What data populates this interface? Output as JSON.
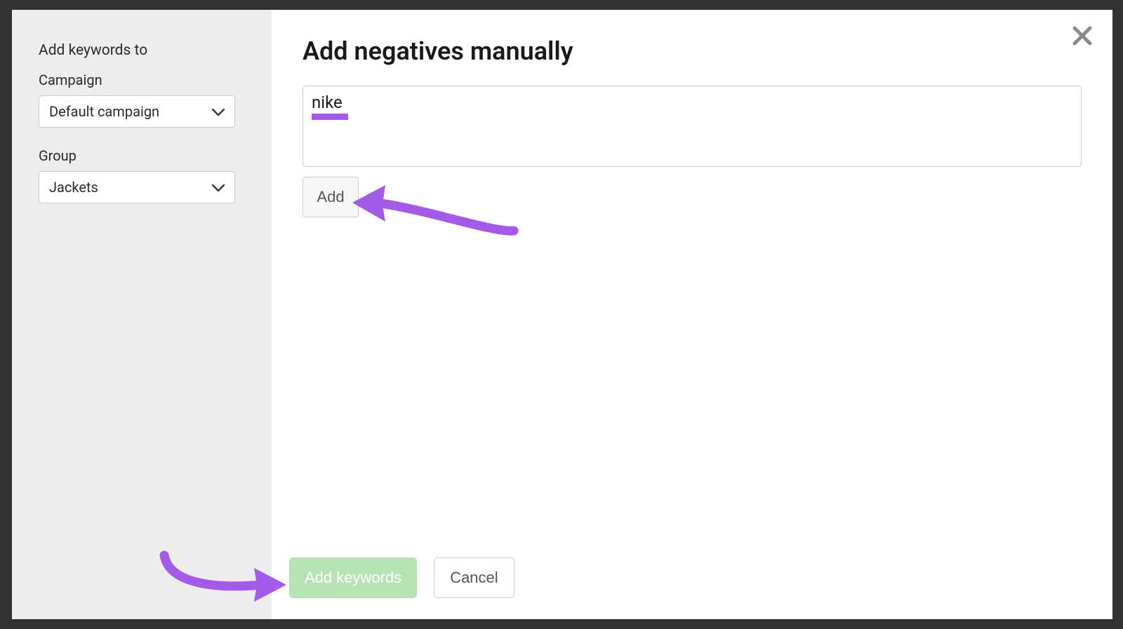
{
  "sidebar": {
    "title": "Add keywords to",
    "campaign_label": "Campaign",
    "campaign_value": "Default campaign",
    "group_label": "Group",
    "group_value": "Jackets"
  },
  "main": {
    "title": "Add negatives manually",
    "textarea_value": "nike",
    "add_label": "Add"
  },
  "footer": {
    "primary_label": "Add keywords",
    "cancel_label": "Cancel"
  },
  "colors": {
    "highlight": "#a45ae8",
    "primary_btn": "#b5e3b3"
  }
}
